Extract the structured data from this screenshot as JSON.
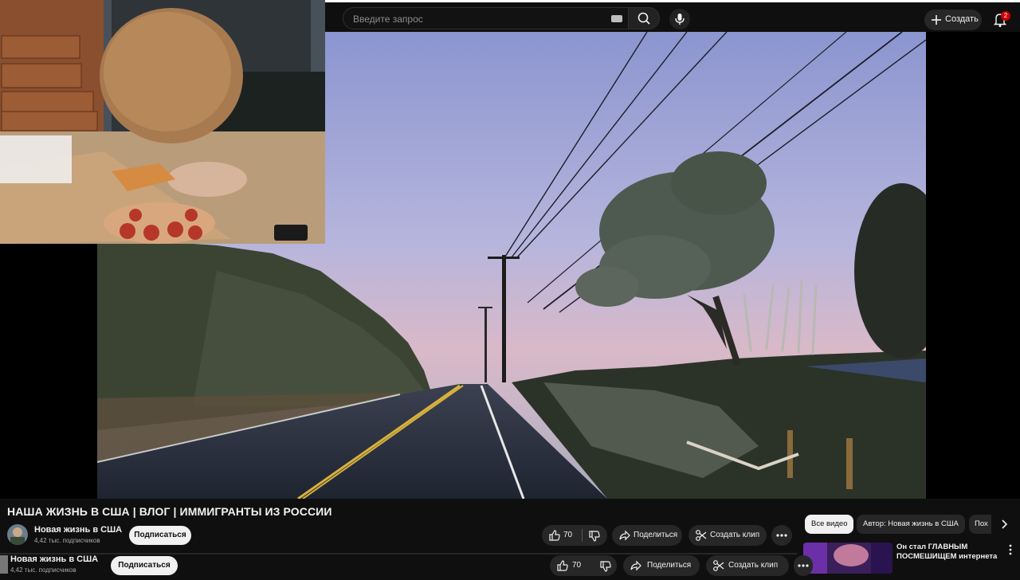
{
  "search": {
    "placeholder": "Введите запрос"
  },
  "header": {
    "create_label": "Создать",
    "notification_count": "2"
  },
  "video": {
    "title": "НАША ЖИЗНЬ В США | ВЛОГ | ИММИГРАНТЫ ИЗ РОССИИ",
    "channel_name": "Новая жизнь в США",
    "subscribers": "4,42 тыс. подписчиков",
    "subscribe_label": "Подписаться",
    "likes": "70",
    "share_label": "Поделиться",
    "clip_label": "Создать клип"
  },
  "chips": [
    {
      "label": "Все видео"
    },
    {
      "label": "Автор: Новая жизнь в США"
    },
    {
      "label": "Пох"
    }
  ],
  "recommendation": {
    "title": "Он стал ГЛАВНЫМ ПОСМЕШИЩЕМ интернета з"
  },
  "duplicate_row": {
    "channel_name": "Новая жизнь в США",
    "subscribers": "4,42 тыс. подписчиков",
    "subscribe_label": "Подписаться",
    "likes": "70",
    "share_label": "Поделиться",
    "clip_label": "Создать клип"
  },
  "icons": {
    "search": "search-icon",
    "mic": "mic-icon",
    "keyboard": "keyboard-icon",
    "create": "plus-icon",
    "bell": "bell-icon",
    "like": "thumbs-up-icon",
    "dislike": "thumbs-down-icon",
    "share": "share-icon",
    "clip": "scissors-icon",
    "more": "more-horizontal-icon",
    "next": "chevron-right-icon",
    "menu": "more-vertical-icon"
  },
  "colors": {
    "background": "#0f0f0f",
    "pill": "#272727",
    "badge": "#cc0000",
    "subscribe": "#f1f1f1"
  }
}
